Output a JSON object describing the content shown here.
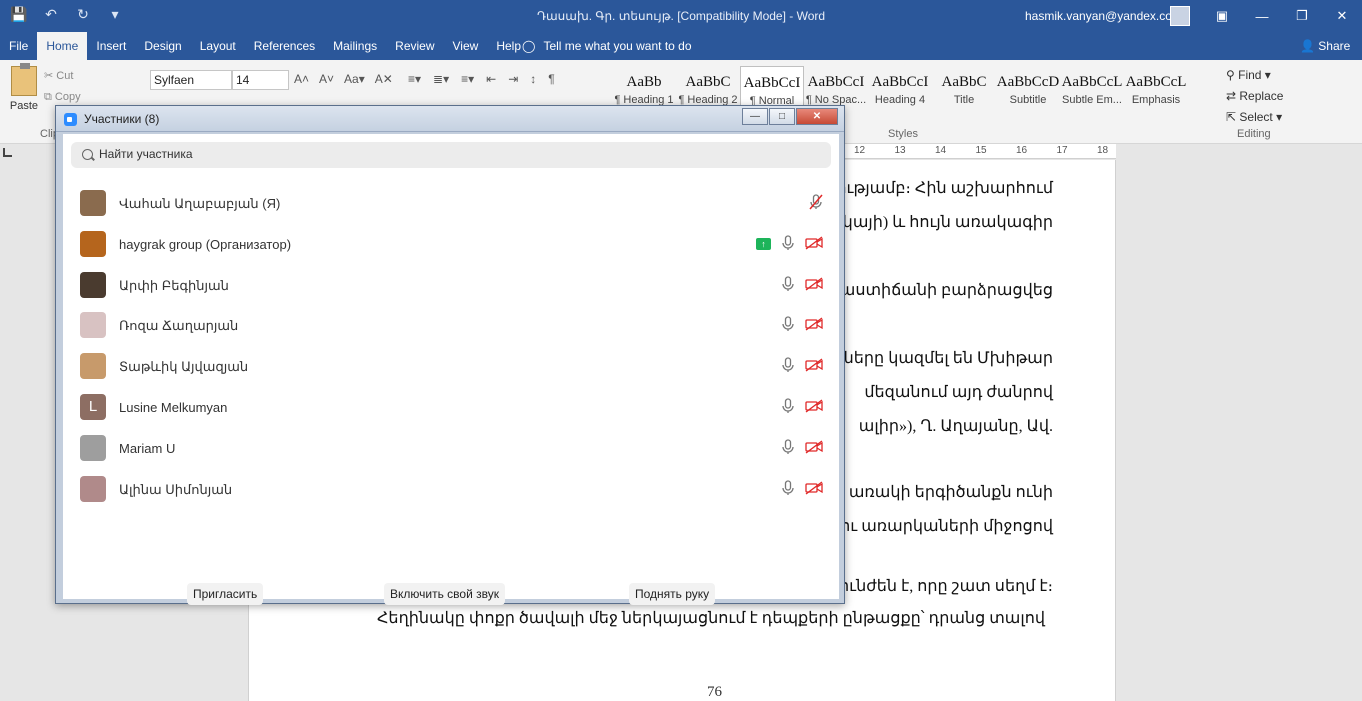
{
  "window": {
    "doc_title": "Դասախ. Գր. տեսույթ. [Compatibility Mode]  -  Word",
    "user": "hasmik.vanyan@yandex.com"
  },
  "ribbon": {
    "tabs": [
      "File",
      "Home",
      "Insert",
      "Design",
      "Layout",
      "References",
      "Mailings",
      "Review",
      "View",
      "Help"
    ],
    "tell_me": "Tell me what you want to do",
    "share": "Share",
    "paste": "Paste",
    "cut": "Cut",
    "copy": "Copy",
    "clipboard_group": "Clip",
    "font_name": "Sylfaen",
    "font_size": "14",
    "styles": [
      {
        "sample": "AaBb",
        "label": "¶ Heading 1"
      },
      {
        "sample": "AaBbC",
        "label": "¶ Heading 2"
      },
      {
        "sample": "AaBbCcI",
        "label": "¶ Normal"
      },
      {
        "sample": "AaBbCcI",
        "label": "¶ No Spac..."
      },
      {
        "sample": "AaBbCcI",
        "label": "Heading 4"
      },
      {
        "sample": "AaBbC",
        "label": "Title"
      },
      {
        "sample": "AaBbCcD",
        "label": "Subtitle"
      },
      {
        "sample": "AaBbCcL",
        "label": "Subtle Em..."
      },
      {
        "sample": "AaBbCcL",
        "label": "Emphasis"
      }
    ],
    "styles_group": "Styles",
    "find": "Find",
    "replace": "Replace",
    "select": "Select",
    "editing_group": "Editing"
  },
  "ruler": [
    "12",
    "13",
    "14",
    "15",
    "16",
    "17",
    "18"
  ],
  "document": {
    "lines": [
      "ությամբ։ Հին աշխարհում",
      "րկայի) և հույն առակագիր",
      "աստիճանի բարձրացվեց",
      "ները կազմել են Մխիթար",
      "մեզանում այդ ժանրով",
      "ալիր»), Ղ. Աղայանը, Ավ.",
      "առակի երգիծանքն ունի",
      "ու առարկաների միջոցով",
      "յունժեն է, որը շատ սեղմ է։",
      "Հեղինակը փոքր ծավալի մեջ ներկայացնում է դեպքերի ընթացքը՝ դրանց տալով"
    ],
    "page_number": "76"
  },
  "participants_dialog": {
    "title": "Участники (8)",
    "search_placeholder": "Найти участника",
    "participants": [
      {
        "name": "Վահան Աղաբաբյան (Я)",
        "avatar_color": "#8a6b4e",
        "muted_mic": true,
        "video_off": true,
        "sharing": false
      },
      {
        "name": "haygrak group (Организатор)",
        "avatar_color": "#b5651d",
        "muted_mic": false,
        "video_off": true,
        "sharing": true
      },
      {
        "name": "Արփի Բեգինյան",
        "avatar_color": "#4a3b2f",
        "muted_mic": false,
        "video_off": true,
        "sharing": false
      },
      {
        "name": "Ռոզա Ճաղարյան",
        "avatar_color": "#d8c2c2",
        "muted_mic": false,
        "video_off": true,
        "sharing": false
      },
      {
        "name": "Տաթևիկ Այվազյան",
        "avatar_color": "#c79a6b",
        "muted_mic": false,
        "video_off": true,
        "sharing": false
      },
      {
        "name": "Lusine Melkumyan",
        "avatar_color": "#8d6e63",
        "avatar_letter": "L",
        "muted_mic": false,
        "video_off": true,
        "sharing": false
      },
      {
        "name": "Mariam U",
        "avatar_color": "#9e9e9e",
        "muted_mic": false,
        "video_off": true,
        "sharing": false
      },
      {
        "name": "Ալինա Սիմոնյան",
        "avatar_color": "#b08a8a",
        "muted_mic": false,
        "video_off": true,
        "sharing": false
      }
    ],
    "invite": "Пригласить",
    "unmute_self": "Включить свой звук",
    "raise_hand": "Поднять руку"
  }
}
